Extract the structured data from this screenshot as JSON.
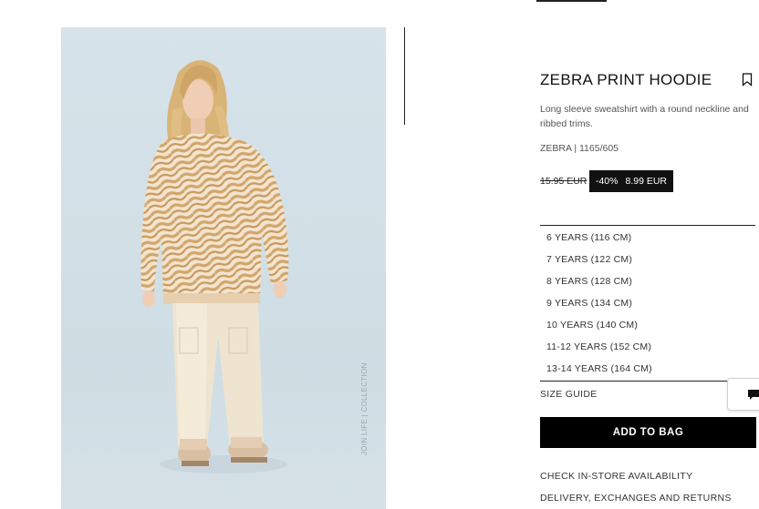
{
  "product": {
    "title": "ZEBRA PRINT HOODIE",
    "description": "Long sleeve sweatshirt with a round neckline and ribbed trims.",
    "reference": "ZEBRA | 1165/605",
    "price": {
      "original": "15.95 EUR",
      "discount": "-40%",
      "current": "8.99 EUR"
    }
  },
  "image": {
    "watermark": "JOIN LIFE | COLLECTION"
  },
  "sizes": [
    "6 YEARS (116 CM)",
    "7 YEARS (122 CM)",
    "8 YEARS (128 CM)",
    "9 YEARS (134 CM)",
    "10 YEARS (140 CM)",
    "11-12 YEARS (152 CM)",
    "13-14 YEARS (164 CM)"
  ],
  "actions": {
    "size_guide": "SIZE GUIDE",
    "add_to_bag": "ADD TO BAG",
    "check_store": "CHECK IN-STORE AVAILABILITY",
    "delivery": "DELIVERY, EXCHANGES AND RETURNS"
  },
  "icons": {
    "bookmark": "bookmark-icon",
    "chat": "chat-icon"
  },
  "colors": {
    "accent": "#000000",
    "text": "#111111",
    "muted": "#555555"
  }
}
